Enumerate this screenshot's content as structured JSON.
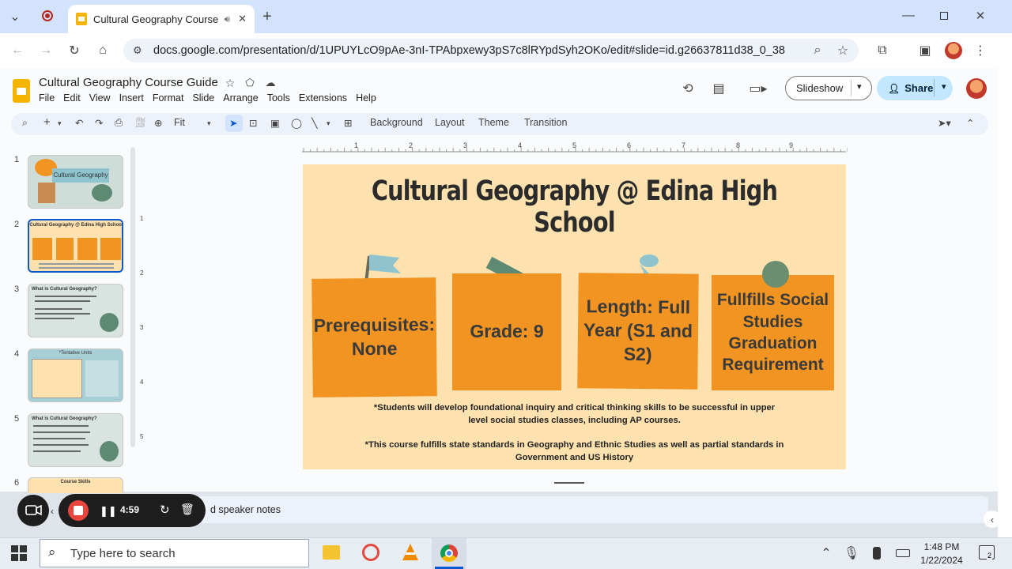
{
  "browser": {
    "tab_title": "Cultural Geography Course",
    "url": "docs.google.com/presentation/d/1UPUYLcO9pAe-3nI-TPAbpxewy3pS7c8lRYpdSyh2OKo/edit#slide=id.g26637811d38_0_38"
  },
  "doc": {
    "title": "Cultural Geography Course Guide",
    "menu": [
      "File",
      "Edit",
      "View",
      "Insert",
      "Format",
      "Slide",
      "Arrange",
      "Tools",
      "Extensions",
      "Help"
    ],
    "zoom": "Fit",
    "toolbar_buttons": [
      "Background",
      "Layout",
      "Theme",
      "Transition"
    ],
    "slideshow_label": "Slideshow",
    "share_label": "Share"
  },
  "filmstrip": {
    "numbers": [
      "1",
      "2",
      "3",
      "4",
      "5",
      "6"
    ],
    "thumb1_title": "Cultural Geography",
    "thumb2_title": "Cultural Geography @ Edina High School",
    "thumb3_title": "What is Cultural Geography?",
    "thumb4_title": "*Tentative Units",
    "thumb5_title": "What is Cultural Geography?",
    "thumb6_title": "Course Skills"
  },
  "ruler": [
    "1",
    "2",
    "3",
    "4",
    "5",
    "6",
    "7",
    "8",
    "9"
  ],
  "vruler": [
    "1",
    "2",
    "3",
    "4",
    "5"
  ],
  "slide": {
    "title": "Cultural Geography @ Edina High School",
    "cards": [
      "Prerequisites: None",
      "Grade: 9",
      "Length: Full Year (S1 and S2)",
      "Fullfills Social Studies Graduation Requirement"
    ],
    "footnote1_line1": "*Students will develop foundational inquiry and critical thinking skills to be successful in upper",
    "footnote1_line2": "level social studies classes, including AP courses.",
    "footnote2_line1": "*This course fulfills state standards in Geography and Ethnic Studies as well as partial standards in",
    "footnote2_line2": "Government and US History"
  },
  "speaker_notes": "d speaker notes",
  "recorder": {
    "time": "4:59"
  },
  "taskbar": {
    "search_placeholder": "Type here to search",
    "time": "1:48 PM",
    "date": "1/22/2024",
    "notification_count": "2"
  },
  "colors": {
    "slide_bg": "#fde1ae",
    "card": "#f29422",
    "accent_blue": "#0b57d0"
  }
}
